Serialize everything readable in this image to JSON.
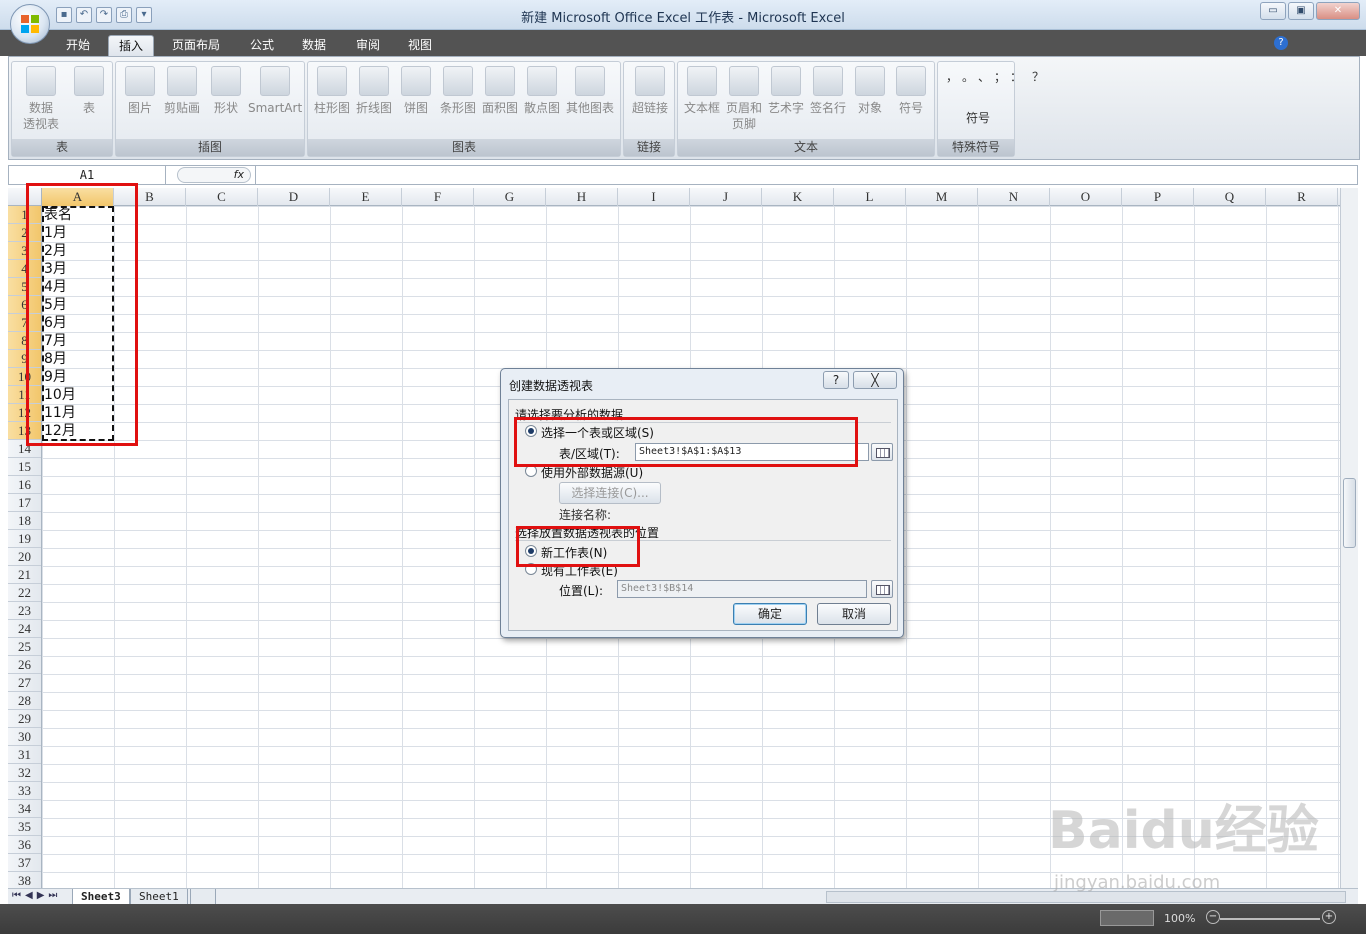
{
  "window": {
    "title": "新建 Microsoft Office Excel 工作表 - Microsoft Excel"
  },
  "ribbon": {
    "tabs": [
      "开始",
      "插入",
      "页面布局",
      "公式",
      "数据",
      "审阅",
      "视图"
    ],
    "active_tab": "插入",
    "groups": [
      {
        "label": "表",
        "buttons": [
          "数据\n透视表",
          "表"
        ]
      },
      {
        "label": "插图",
        "buttons": [
          "图片",
          "剪贴画",
          "形状",
          "SmartArt"
        ]
      },
      {
        "label": "图表",
        "buttons": [
          "柱形图",
          "折线图",
          "饼图",
          "条形图",
          "面积图",
          "散点图",
          "其他图表"
        ]
      },
      {
        "label": "链接",
        "buttons": [
          "超链接"
        ]
      },
      {
        "label": "文本",
        "buttons": [
          "文本框",
          "页眉和\n页脚",
          "艺术字",
          "签名行",
          "对象",
          "符号"
        ]
      },
      {
        "label": "特殊符号",
        "buttons": [
          "符号"
        ]
      }
    ]
  },
  "formula_bar": {
    "name_box": "A1",
    "fx": "fx",
    "content": ""
  },
  "grid": {
    "columns": [
      "A",
      "B",
      "C",
      "D",
      "E",
      "F",
      "G",
      "H",
      "I",
      "J",
      "K",
      "L",
      "M",
      "N",
      "O",
      "P",
      "Q",
      "R"
    ],
    "rows": [
      "1",
      "2",
      "3",
      "4",
      "5",
      "6",
      "7",
      "8",
      "9",
      "10",
      "11",
      "12",
      "13",
      "14",
      "15",
      "16",
      "17",
      "18",
      "19",
      "20",
      "21",
      "22",
      "23",
      "24",
      "25",
      "26",
      "27",
      "28",
      "29",
      "30",
      "31",
      "32",
      "33",
      "34",
      "35",
      "36",
      "37",
      "38"
    ],
    "column_a": [
      "表名",
      "1月",
      "2月",
      "3月",
      "4月",
      "5月",
      "6月",
      "7月",
      "8月",
      "9月",
      "10月",
      "11月",
      "12月"
    ]
  },
  "sheet_tabs": [
    "Sheet3",
    "Sheet1"
  ],
  "status": {
    "zoom": "100%"
  },
  "dialog": {
    "title": "创建数据透视表",
    "help": "?",
    "close": "╳",
    "section1": "请选择要分析的数据",
    "opt_range": "选择一个表或区域(S)",
    "range_label": "表/区域(T):",
    "range_value": "Sheet3!$A$1:$A$13",
    "opt_external": "使用外部数据源(U)",
    "choose_conn": "选择连接(C)...",
    "conn_name": "连接名称:",
    "section2": "选择放置数据透视表的位置",
    "opt_new": "新工作表(N)",
    "opt_existing": "现有工作表(E)",
    "location_label": "位置(L):",
    "location_value": "Sheet3!$B$14",
    "ok": "确定",
    "cancel": "取消"
  },
  "watermark": {
    "logo": "Baidu经验",
    "url": "jingyan.baidu.com"
  },
  "colors": {
    "accent_red": "#e01010",
    "status_bar": "#444444",
    "selection": "#f2c66b"
  }
}
